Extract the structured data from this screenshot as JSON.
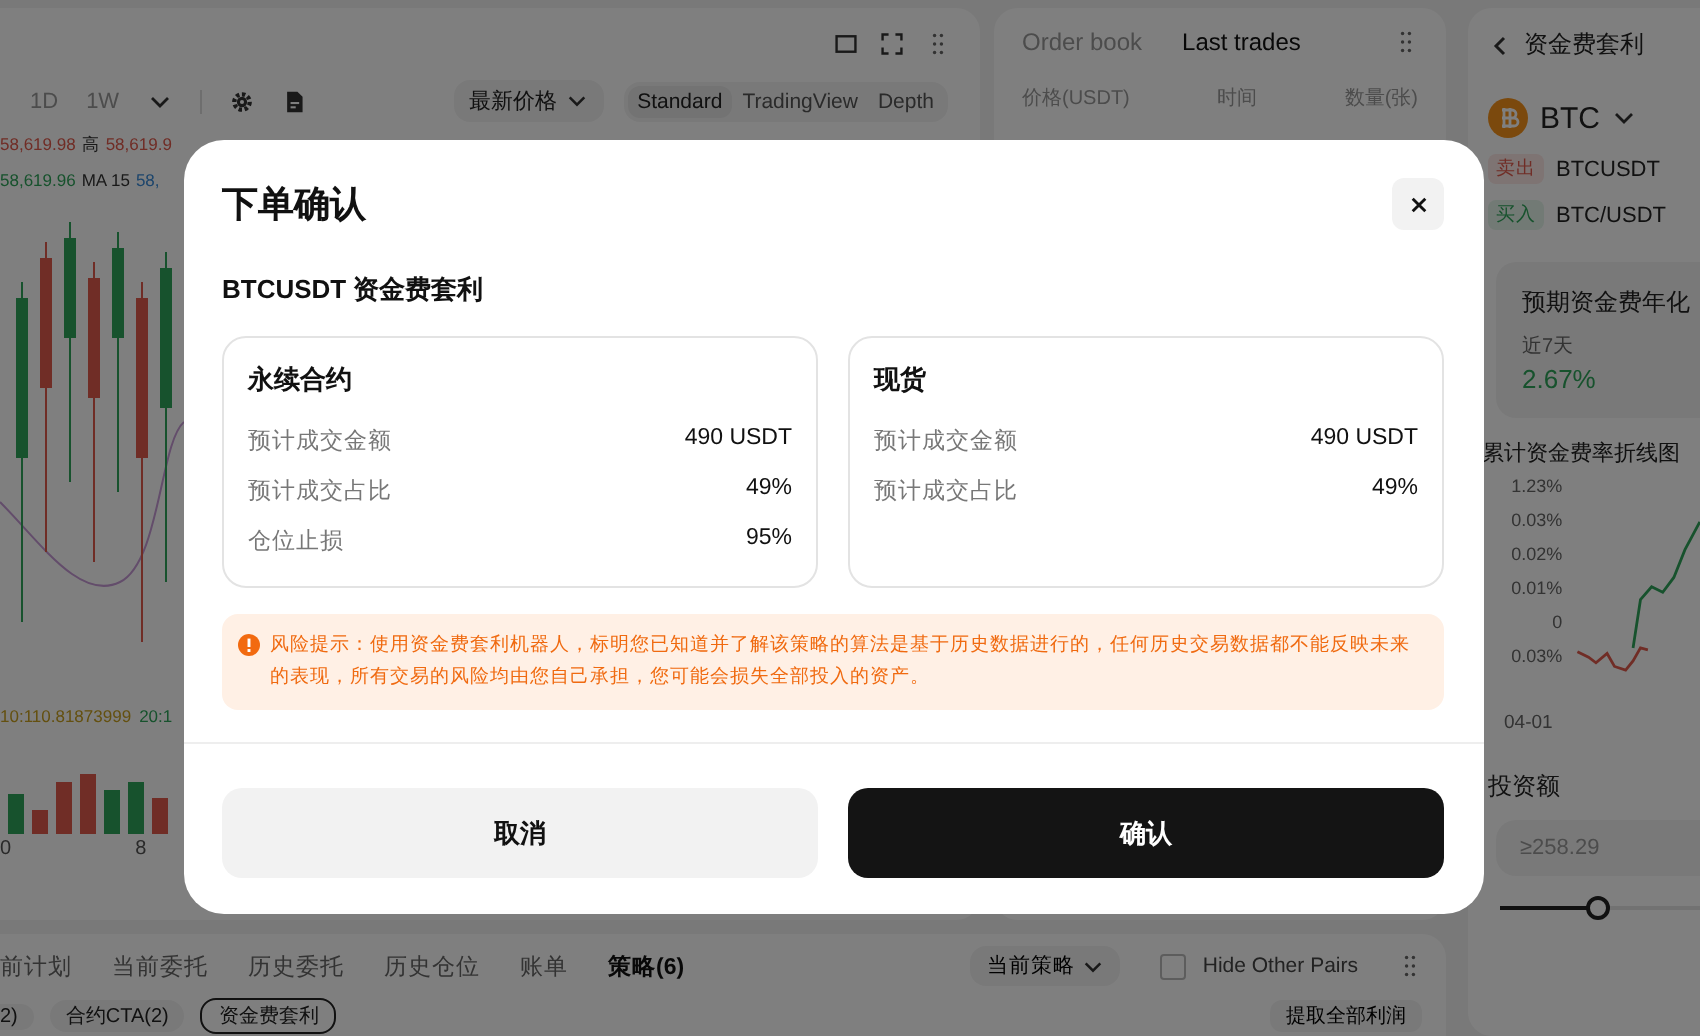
{
  "chart_panel": {
    "intervals": [
      {
        "label": "1D",
        "selected": false
      },
      {
        "label": "1W",
        "selected": false
      }
    ],
    "price_type": "最新价格",
    "views": [
      {
        "label": "Standard",
        "selected": true
      },
      {
        "label": "TradingView",
        "selected": false
      },
      {
        "label": "Depth",
        "selected": false
      }
    ],
    "ohlc_line": [
      {
        "text": "58,619.98",
        "kind": "down"
      },
      {
        "text": "高",
        "kind": "label"
      },
      {
        "text": "58,619.9",
        "kind": "down"
      }
    ],
    "ma_line": [
      {
        "text": "58,619.96",
        "kind": "up"
      },
      {
        "text": "MA 15",
        "kind": "label"
      },
      {
        "text": "58,",
        "kind": "blue"
      }
    ],
    "volume_legend": [
      {
        "text": "10:110.81873999",
        "kind": "gold"
      },
      {
        "text": "20:1",
        "kind": "up"
      }
    ],
    "x_labels": [
      "0",
      "8"
    ]
  },
  "order_book": {
    "tabs": [
      {
        "label": "Order book",
        "selected": false
      },
      {
        "label": "Last trades",
        "selected": true
      }
    ],
    "columns": [
      "价格(USDT)",
      "时间",
      "数量(张)"
    ]
  },
  "strategy_panel": {
    "title": "资金费套利",
    "coin": "BTC",
    "legs": [
      {
        "side": "卖出",
        "kind": "sell",
        "pair": "BTCUSDT"
      },
      {
        "side": "买入",
        "kind": "buy",
        "pair": "BTC/USDT"
      }
    ],
    "forecast": {
      "title": "预期资金费年化",
      "periods": [
        {
          "label": "近7天",
          "value": "2.67%"
        }
      ]
    },
    "rate_chart": {
      "title": "累计资金费率折线图",
      "y_labels": [
        "1.23%",
        "0.03%",
        "0.02%",
        "0.01%",
        "0",
        "0.03%"
      ],
      "x_labels": [
        "04-01"
      ]
    },
    "investment": {
      "label": "投资额",
      "placeholder": "≥258.29",
      "level": 0.45
    }
  },
  "bottom_panel": {
    "tabs": [
      {
        "label": "前计划",
        "selected": false
      },
      {
        "label": "当前委托",
        "selected": false
      },
      {
        "label": "历史委托",
        "selected": false
      },
      {
        "label": "历史仓位",
        "selected": false
      },
      {
        "label": "账单",
        "selected": false
      },
      {
        "label": "策略(6)",
        "selected": true
      }
    ],
    "strategy_filter": "当前策略",
    "hide_other_pairs": {
      "label": "Hide Other Pairs",
      "checked": false
    },
    "chips": [
      {
        "label": "2)",
        "selected": false
      },
      {
        "label": "合约CTA(2)",
        "selected": false
      },
      {
        "label": "资金费套利",
        "selected": true
      }
    ],
    "withdraw_button": "提取全部利润"
  },
  "modal": {
    "title": "下单确认",
    "subtitle": "BTCUSDT 资金费套利",
    "cards": [
      {
        "title": "永续合约",
        "rows": [
          {
            "label": "预计成交金额",
            "value": "490 USDT"
          },
          {
            "label": "预计成交占比",
            "value": "49%"
          },
          {
            "label": "仓位止损",
            "value": "95%"
          }
        ]
      },
      {
        "title": "现货",
        "rows": [
          {
            "label": "预计成交金额",
            "value": "490 USDT"
          },
          {
            "label": "预计成交占比",
            "value": "49%"
          }
        ]
      }
    ],
    "risk_notice": "风险提示：使用资金费套利机器人，标明您已知道并了解该策略的算法是基于历史数据进行的，任何历史交易数据都不能反映未来的表现，所有交易的风险均由您自己承担，您可能会损失全部投入的资产。",
    "buttons": [
      {
        "label": "取消",
        "kind": "secondary"
      },
      {
        "label": "确认",
        "kind": "primary"
      }
    ]
  }
}
